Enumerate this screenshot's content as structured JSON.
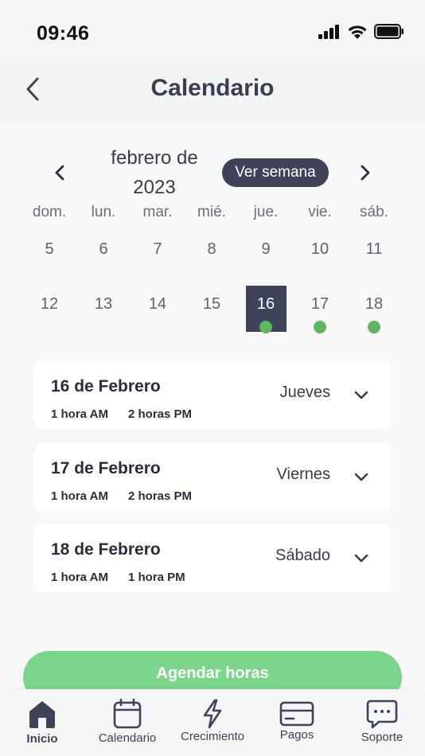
{
  "status_bar": {
    "time": "09:46"
  },
  "header": {
    "title": "Calendario"
  },
  "calendar": {
    "month_label": "febrero de 2023",
    "week_toggle_label": "Ver semana",
    "weekdays": [
      "dom.",
      "lun.",
      "mar.",
      "mié.",
      "jue.",
      "vie.",
      "sáb."
    ],
    "week1": [
      {
        "day": "5",
        "selected": false,
        "event": false
      },
      {
        "day": "6",
        "selected": false,
        "event": false
      },
      {
        "day": "7",
        "selected": false,
        "event": false
      },
      {
        "day": "8",
        "selected": false,
        "event": false
      },
      {
        "day": "9",
        "selected": false,
        "event": false
      },
      {
        "day": "10",
        "selected": false,
        "event": false
      },
      {
        "day": "11",
        "selected": false,
        "event": false
      }
    ],
    "week2": [
      {
        "day": "12",
        "selected": false,
        "event": false
      },
      {
        "day": "13",
        "selected": false,
        "event": false
      },
      {
        "day": "14",
        "selected": false,
        "event": false
      },
      {
        "day": "15",
        "selected": false,
        "event": false
      },
      {
        "day": "16",
        "selected": true,
        "event": true
      },
      {
        "day": "17",
        "selected": false,
        "event": true
      },
      {
        "day": "18",
        "selected": false,
        "event": true
      }
    ]
  },
  "bookings": [
    {
      "date": "16 de Febrero",
      "weekday": "Jueves",
      "slot_am": "1 hora AM",
      "slot_pm": "2 horas PM"
    },
    {
      "date": "17 de Febrero",
      "weekday": "Viernes",
      "slot_am": "1 hora AM",
      "slot_pm": "2 horas PM"
    },
    {
      "date": "18 de Febrero",
      "weekday": "Sábado",
      "slot_am": "1 hora AM",
      "slot_pm": "1 hora PM"
    }
  ],
  "cta": {
    "label": "Agendar horas"
  },
  "tabs": [
    {
      "label": "Inicio",
      "icon": "home-icon",
      "active": true
    },
    {
      "label": "Calendario",
      "icon": "calendar-icon",
      "active": false
    },
    {
      "label": "Crecimiento",
      "icon": "lightning-icon",
      "active": false
    },
    {
      "label": "Pagos",
      "icon": "card-icon",
      "active": false
    },
    {
      "label": "Soporte",
      "icon": "chat-icon",
      "active": false
    }
  ],
  "colors": {
    "primary": "#3f435a",
    "accent_green": "#5cb85c",
    "cta_green": "#7bd68a",
    "background": "#f8f8f9"
  }
}
